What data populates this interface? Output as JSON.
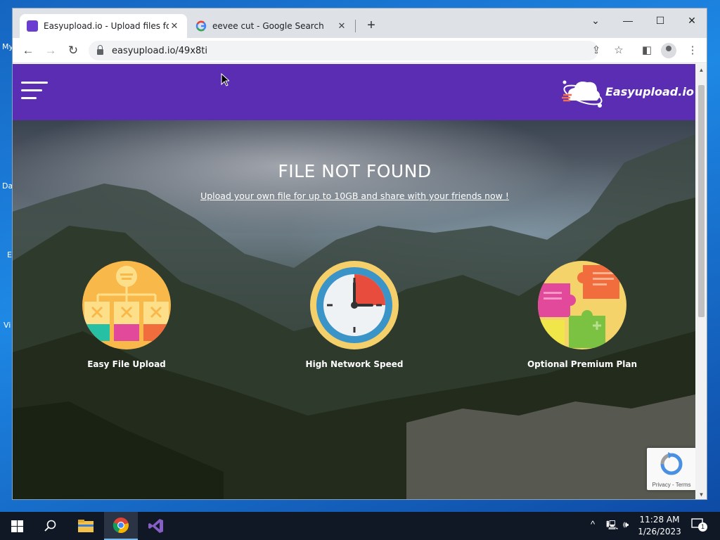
{
  "desktop": {
    "labels": [
      "My",
      "Da",
      "E",
      "Vi"
    ]
  },
  "browser": {
    "tabs": [
      {
        "title": "Easyupload.io - Upload files for f",
        "active": true
      },
      {
        "title": "eevee cut - Google Search",
        "active": false
      }
    ],
    "new_tab": "+",
    "window_controls": {
      "dropdown": "⌄",
      "minimize": "—",
      "maximize": "☐",
      "close": "✕"
    },
    "url": "easyupload.io/49x8ti"
  },
  "site": {
    "logo_text": "Easyupload.io",
    "hero_title": "FILE NOT FOUND",
    "hero_link": "Upload your own file for up to 10GB and share with your friends now !",
    "features": [
      {
        "label": "Easy File Upload",
        "icon": "file-hierarchy-icon"
      },
      {
        "label": "High Network Speed",
        "icon": "clock-icon"
      },
      {
        "label": "Optional Premium Plan",
        "icon": "puzzle-icon"
      }
    ],
    "recaptcha_terms": "Privacy - Terms"
  },
  "taskbar": {
    "time": "11:28 AM",
    "date": "1/26/2023",
    "notification_count": "1"
  },
  "colors": {
    "site_header": "#5b2db3",
    "taskbar": "#101826"
  }
}
